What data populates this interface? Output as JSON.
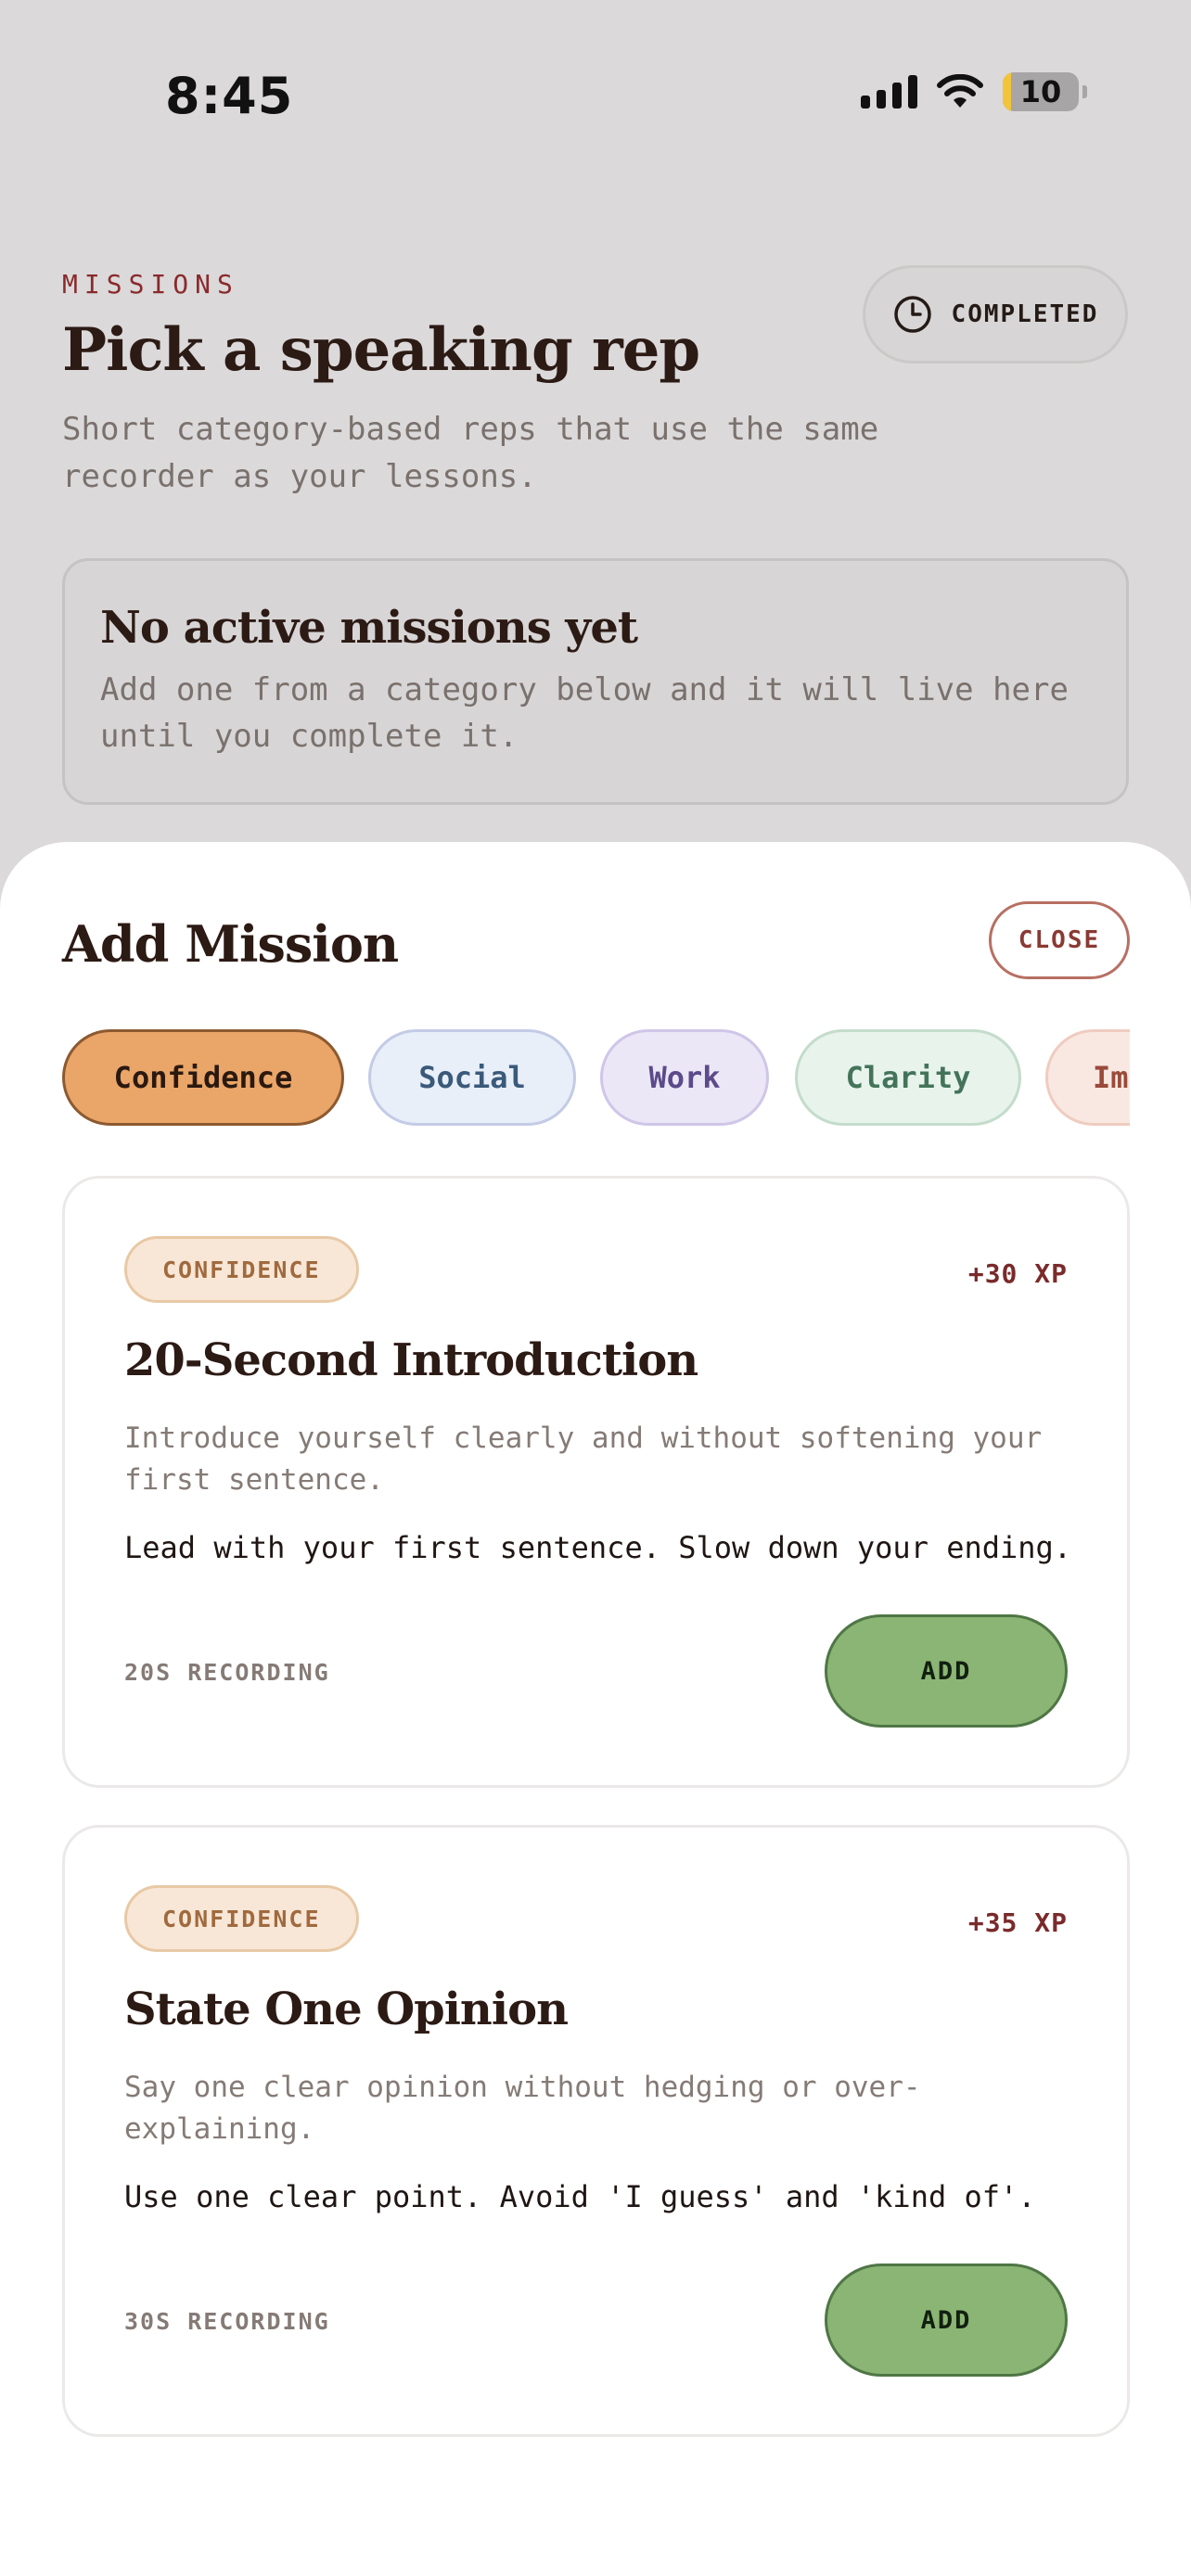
{
  "status_bar": {
    "time": "8:45",
    "battery": "10"
  },
  "header": {
    "eyebrow": "MISSIONS",
    "title": "Pick a speaking rep",
    "subtitle": "Short category-based reps that use the same recorder as your lessons.",
    "completed_label": "COMPLETED"
  },
  "empty_state": {
    "title": "No active missions yet",
    "text": "Add one from a category below and it will live here until you complete it."
  },
  "sheet": {
    "title": "Add Mission",
    "close_label": "CLOSE",
    "categories": [
      {
        "label": "Confidence",
        "selected": true
      },
      {
        "label": "Social"
      },
      {
        "label": "Work"
      },
      {
        "label": "Clarity"
      },
      {
        "label": "Im"
      }
    ],
    "missions": [
      {
        "category": "CONFIDENCE",
        "xp": "+30 XP",
        "title": "20-Second Introduction",
        "description": "Introduce yourself clearly and without softening your first sentence.",
        "tip": "Lead with your first sentence. Slow down your ending.",
        "duration": "20S RECORDING",
        "add_label": "ADD"
      },
      {
        "category": "CONFIDENCE",
        "xp": "+35 XP",
        "title": "State One Opinion",
        "description": "Say one clear opinion without hedging or over-explaining.",
        "tip": "Use one clear point. Avoid 'I guess' and 'kind of'.",
        "duration": "30S RECORDING",
        "add_label": "ADD"
      }
    ]
  },
  "colors": {
    "accent_selected": "#eaa568",
    "add_button": "#8bb574",
    "eyebrow": "#8a2a2c"
  }
}
